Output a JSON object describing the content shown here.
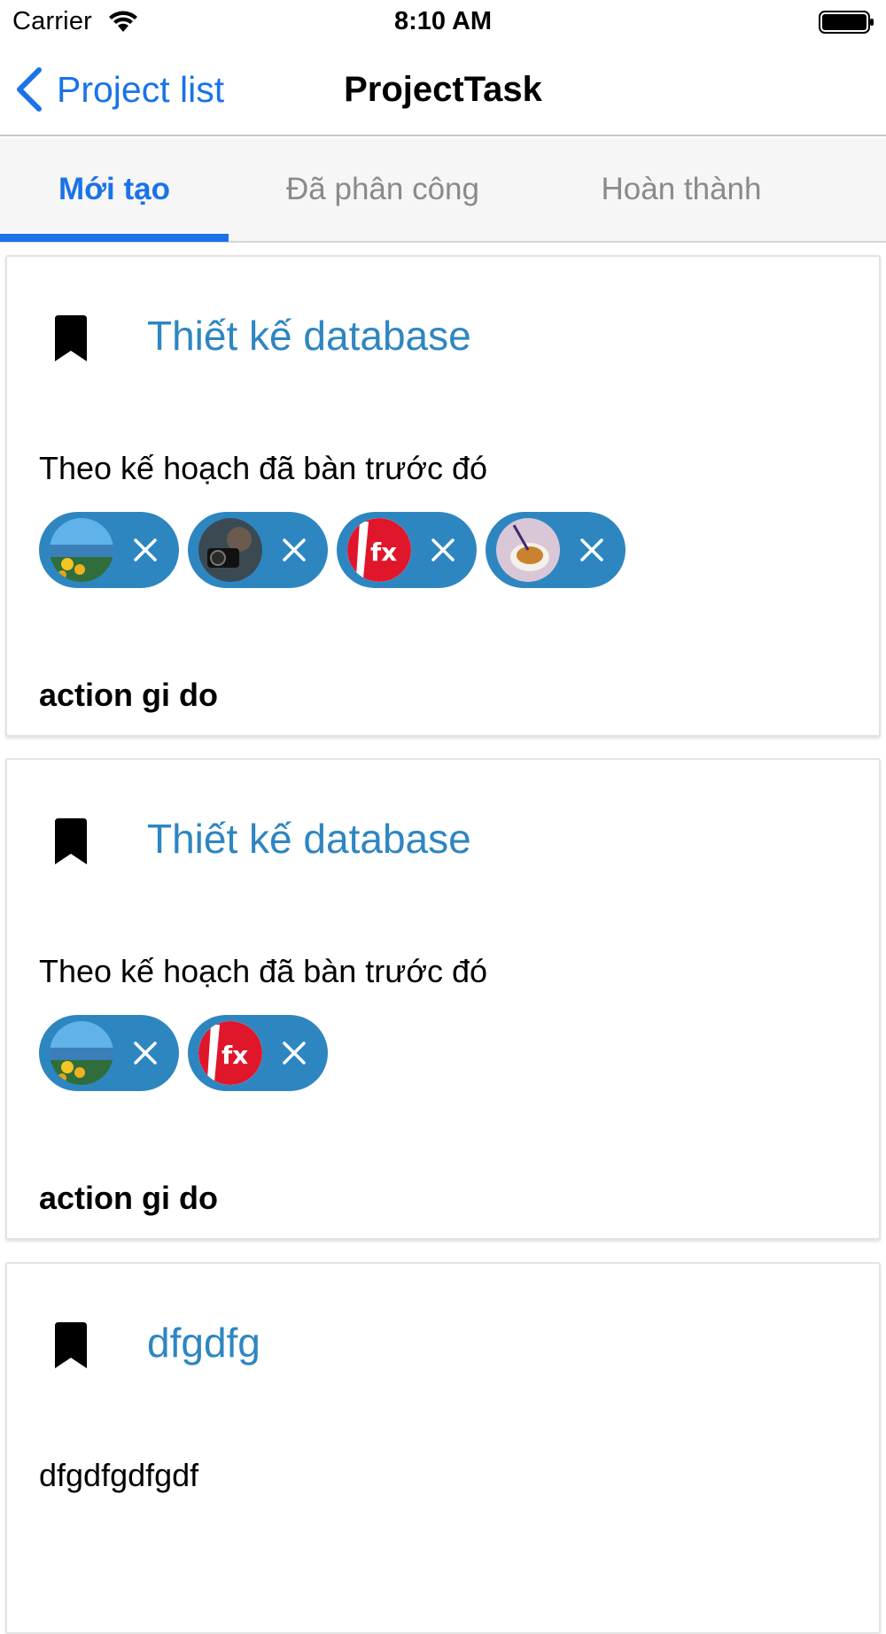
{
  "status_bar": {
    "carrier": "Carrier",
    "time": "8:10 AM",
    "icons": [
      "wifi-icon",
      "battery-icon"
    ]
  },
  "nav": {
    "back_label": "Project list",
    "title": "ProjectTask",
    "back_icon": "chevron-left-icon"
  },
  "tabs": [
    {
      "label": "Mới tạo",
      "active": true
    },
    {
      "label": "Đã phân công",
      "active": false
    },
    {
      "label": "Hoàn thành",
      "active": false
    }
  ],
  "cards": [
    {
      "title": "Thiết kế database",
      "description": "Theo kế hoạch đã bàn trước đó",
      "assignees": [
        "avatar-landscape",
        "avatar-camera",
        "avatar-fx-logo",
        "avatar-coffee"
      ],
      "action": "action gi do"
    },
    {
      "title": "Thiết kế database",
      "description": "Theo kế hoạch đã bàn trước đó",
      "assignees": [
        "avatar-landscape",
        "avatar-fx-logo"
      ],
      "action": "action gi do"
    },
    {
      "title": "dfgdfg",
      "description": "dfgdfgdfgdf",
      "assignees": [],
      "action": ""
    }
  ],
  "colors": {
    "accent": "#1a73e8",
    "card_title": "#2e86c1",
    "chip_bg": "#2e86c1",
    "tab_bg": "#f6f6f6",
    "inactive_tab": "#8a8a8a"
  }
}
